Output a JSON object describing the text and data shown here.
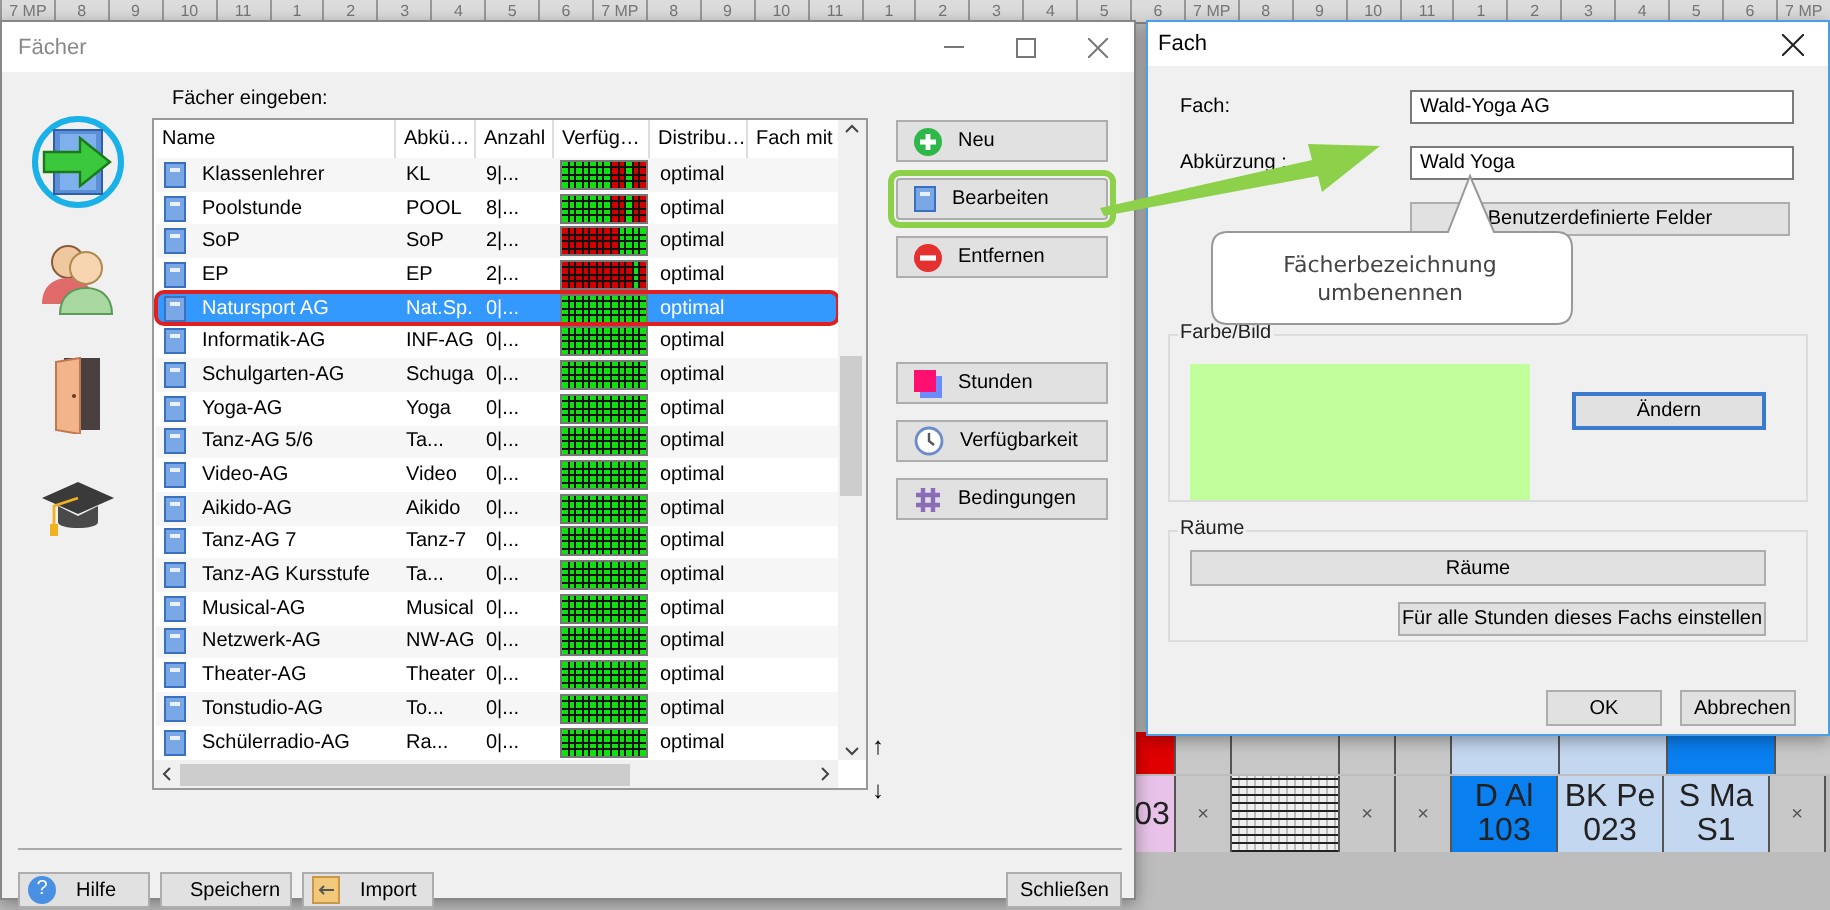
{
  "timetable": {
    "periods": [
      "7 MP",
      "8",
      "9",
      "10",
      "11",
      "1",
      "2",
      "3",
      "4",
      "5",
      "6",
      "7 MP",
      "8",
      "9",
      "10",
      "11",
      "1",
      "2",
      "3",
      "4",
      "5",
      "6",
      "7 MP",
      "8",
      "9",
      "10",
      "11",
      "1",
      "2",
      "3",
      "4",
      "5",
      "6",
      "7 MP"
    ],
    "upper_row": [
      {
        "color": "#e00000"
      },
      {
        "color": "#c8c8c8"
      },
      {
        "color": "#c8c8c8"
      },
      {
        "color": "#c8c8c8"
      },
      {
        "color": "#c8c8c8"
      },
      {
        "color": "#c3d7f0"
      },
      {
        "color": "#c3d7f0"
      },
      {
        "color": "#0a7ff0"
      },
      {
        "color": "#c8c8c8"
      }
    ],
    "lower_row": [
      {
        "kind": "text",
        "text": "03",
        "color": "#e8c2e8"
      },
      {
        "kind": "text",
        "text": "×",
        "color": "#c8c8c8"
      },
      {
        "kind": "hatch",
        "color": "#e8e8e8"
      },
      {
        "kind": "text",
        "text": "×",
        "color": "#c8c8c8"
      },
      {
        "kind": "text",
        "text": "×",
        "color": "#c8c8c8"
      },
      {
        "kind": "text",
        "text": "D Al 103",
        "color": "#0a7ff0"
      },
      {
        "kind": "text",
        "text": "BK Pe 023",
        "color": "#c3d7f0"
      },
      {
        "kind": "text",
        "text": "S Ma S1",
        "color": "#c3d7f0"
      },
      {
        "kind": "text",
        "text": "×",
        "color": "#c8c8c8"
      }
    ]
  },
  "main_window": {
    "title": "Fächer",
    "sidebar": [
      {
        "kind": "subjects",
        "selected": true
      },
      {
        "kind": "teachers",
        "selected": false
      },
      {
        "kind": "rooms",
        "selected": false
      },
      {
        "kind": "classes",
        "selected": false
      }
    ],
    "list_label": "Fächer eingeben:",
    "columns": [
      "Name",
      "Abkü…",
      "Anzahl",
      "Verfüg…",
      "Distribu…",
      "Fach mit"
    ],
    "rows": [
      {
        "name": "Klassenlehrer",
        "abbr": "KL",
        "count": "9|...",
        "kind": "late_blocked",
        "distribution": "optimal",
        "selected": false
      },
      {
        "name": "Poolstunde",
        "abbr": "POOL",
        "count": "8|...",
        "kind": "late_blocked",
        "distribution": "optimal",
        "selected": false
      },
      {
        "name": "SoP",
        "abbr": "SoP",
        "count": "2|...",
        "kind": "early_blocked",
        "distribution": "optimal",
        "selected": false
      },
      {
        "name": "EP",
        "abbr": "EP",
        "count": "2|...",
        "kind": "mostly_blocked",
        "distribution": "optimal",
        "selected": false
      },
      {
        "name": "Natursport AG",
        "abbr": "Nat.Sp.",
        "count": "0|...",
        "kind": "free",
        "distribution": "optimal",
        "selected": true
      },
      {
        "name": "Informatik-AG",
        "abbr": "INF-AG",
        "count": "0|...",
        "kind": "free",
        "distribution": "optimal",
        "selected": false
      },
      {
        "name": "Schulgarten-AG",
        "abbr": "Schuga",
        "count": "0|...",
        "kind": "free",
        "distribution": "optimal",
        "selected": false
      },
      {
        "name": "Yoga-AG",
        "abbr": "Yoga",
        "count": "0|...",
        "kind": "free",
        "distribution": "optimal",
        "selected": false
      },
      {
        "name": "Tanz-AG 5/6",
        "abbr": "Ta...",
        "count": "0|...",
        "kind": "free",
        "distribution": "optimal",
        "selected": false
      },
      {
        "name": "Video-AG",
        "abbr": "Video",
        "count": "0|...",
        "kind": "free",
        "distribution": "optimal",
        "selected": false
      },
      {
        "name": "Aikido-AG",
        "abbr": "Aikido",
        "count": "0|...",
        "kind": "free",
        "distribution": "optimal",
        "selected": false
      },
      {
        "name": "Tanz-AG 7",
        "abbr": "Tanz-7",
        "count": "0|...",
        "kind": "free",
        "distribution": "optimal",
        "selected": false
      },
      {
        "name": "Tanz-AG Kursstufe",
        "abbr": "Ta...",
        "count": "0|...",
        "kind": "free",
        "distribution": "optimal",
        "selected": false
      },
      {
        "name": "Musical-AG",
        "abbr": "Musical",
        "count": "0|...",
        "kind": "free",
        "distribution": "optimal",
        "selected": false
      },
      {
        "name": "Netzwerk-AG",
        "abbr": "NW-AG",
        "count": "0|...",
        "kind": "free",
        "distribution": "optimal",
        "selected": false
      },
      {
        "name": "Theater-AG",
        "abbr": "Theater",
        "count": "0|...",
        "kind": "free",
        "distribution": "optimal",
        "selected": false
      },
      {
        "name": "Tonstudio-AG",
        "abbr": "To...",
        "count": "0|...",
        "kind": "free",
        "distribution": "optimal",
        "selected": false
      },
      {
        "name": "Schülerradio-AG",
        "abbr": "Ra...",
        "count": "0|...",
        "kind": "free",
        "distribution": "optimal",
        "selected": false
      }
    ],
    "actions": [
      {
        "kind": "new",
        "label": "Neu",
        "highlighted": false
      },
      {
        "kind": "edit",
        "label": "Bearbeiten",
        "highlighted": true
      },
      {
        "kind": "remove",
        "label": "Entfernen",
        "highlighted": false
      },
      {
        "kind": "lessons",
        "label": "Stunden",
        "highlighted": false
      },
      {
        "kind": "availability",
        "label": "Verfügbarkeit",
        "highlighted": false
      },
      {
        "kind": "conditions",
        "label": "Bedingungen",
        "highlighted": false
      }
    ],
    "move_up": "↑",
    "move_down": "↓",
    "footer": [
      {
        "kind": "help",
        "label": "Hilfe",
        "icon": "?"
      },
      {
        "kind": "save",
        "label": "Speichern"
      },
      {
        "kind": "import",
        "label": "Import"
      }
    ],
    "close": "Schließen"
  },
  "dialog": {
    "title": "Fach",
    "subject_label": "Fach:",
    "subject_value": "Wald-Yoga AG",
    "abbr_label": "Abkürzung :",
    "abbr_value": "Wald Yoga",
    "custom_fields": "Benutzerdefinierte Felder",
    "color_group": "Farbe/Bild",
    "color": "#c0ff9c",
    "change": "Ändern",
    "rooms_group": "Räume",
    "rooms_button": "Räume",
    "apply_all": "Für alle Stunden dieses Fachs einstellen",
    "ok": "OK",
    "cancel": "Abbrechen"
  },
  "callout": {
    "text": "Fächerbezeichnung umbenennen"
  }
}
